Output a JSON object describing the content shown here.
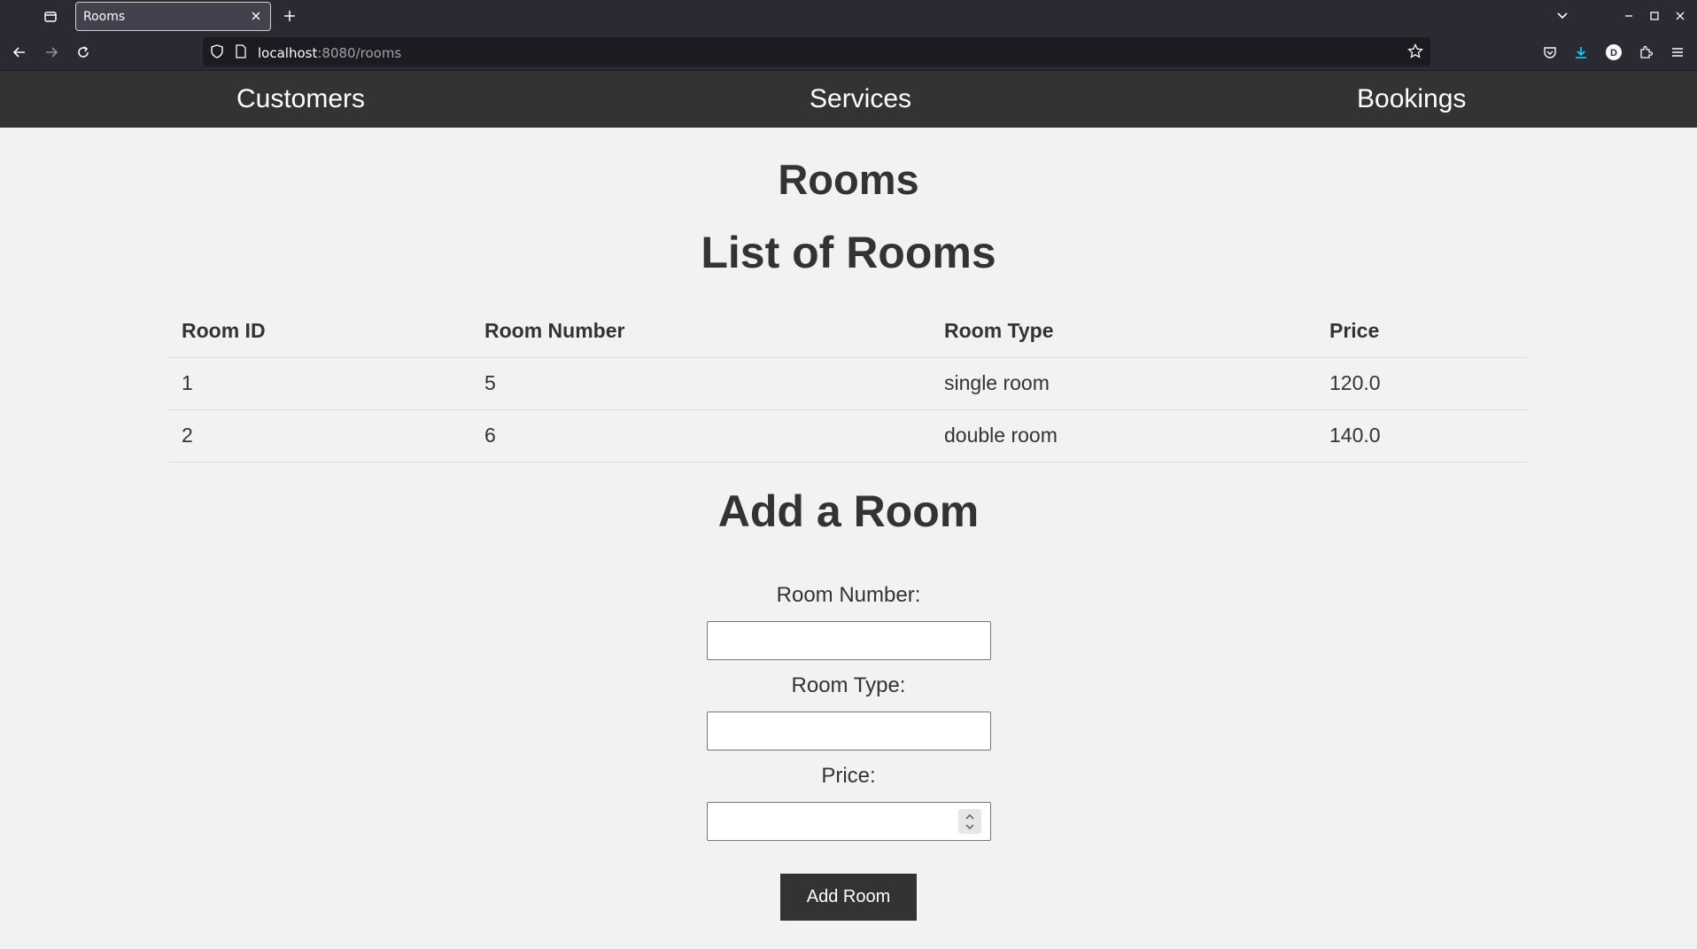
{
  "browser": {
    "tab_title": "Rooms",
    "url_host": "localhost",
    "url_rest": ":8080/rooms",
    "profile_initial": "D"
  },
  "site_nav": {
    "items": [
      "Customers",
      "Services",
      "Bookings"
    ]
  },
  "page": {
    "title": "Rooms",
    "list_heading": "List of Rooms",
    "add_heading": "Add a Room"
  },
  "table": {
    "headers": [
      "Room ID",
      "Room Number",
      "Room Type",
      "Price"
    ],
    "rows": [
      [
        "1",
        "5",
        "single room",
        "120.0"
      ],
      [
        "2",
        "6",
        "double room",
        "140.0"
      ]
    ]
  },
  "form": {
    "room_number_label": "Room Number:",
    "room_type_label": "Room Type:",
    "price_label": "Price:",
    "room_number_value": "",
    "room_type_value": "",
    "price_value": "",
    "submit_label": "Add Room"
  },
  "colors": {
    "nav_bg": "#333333",
    "page_bg": "#f2f2f2",
    "button_bg": "#333333"
  }
}
